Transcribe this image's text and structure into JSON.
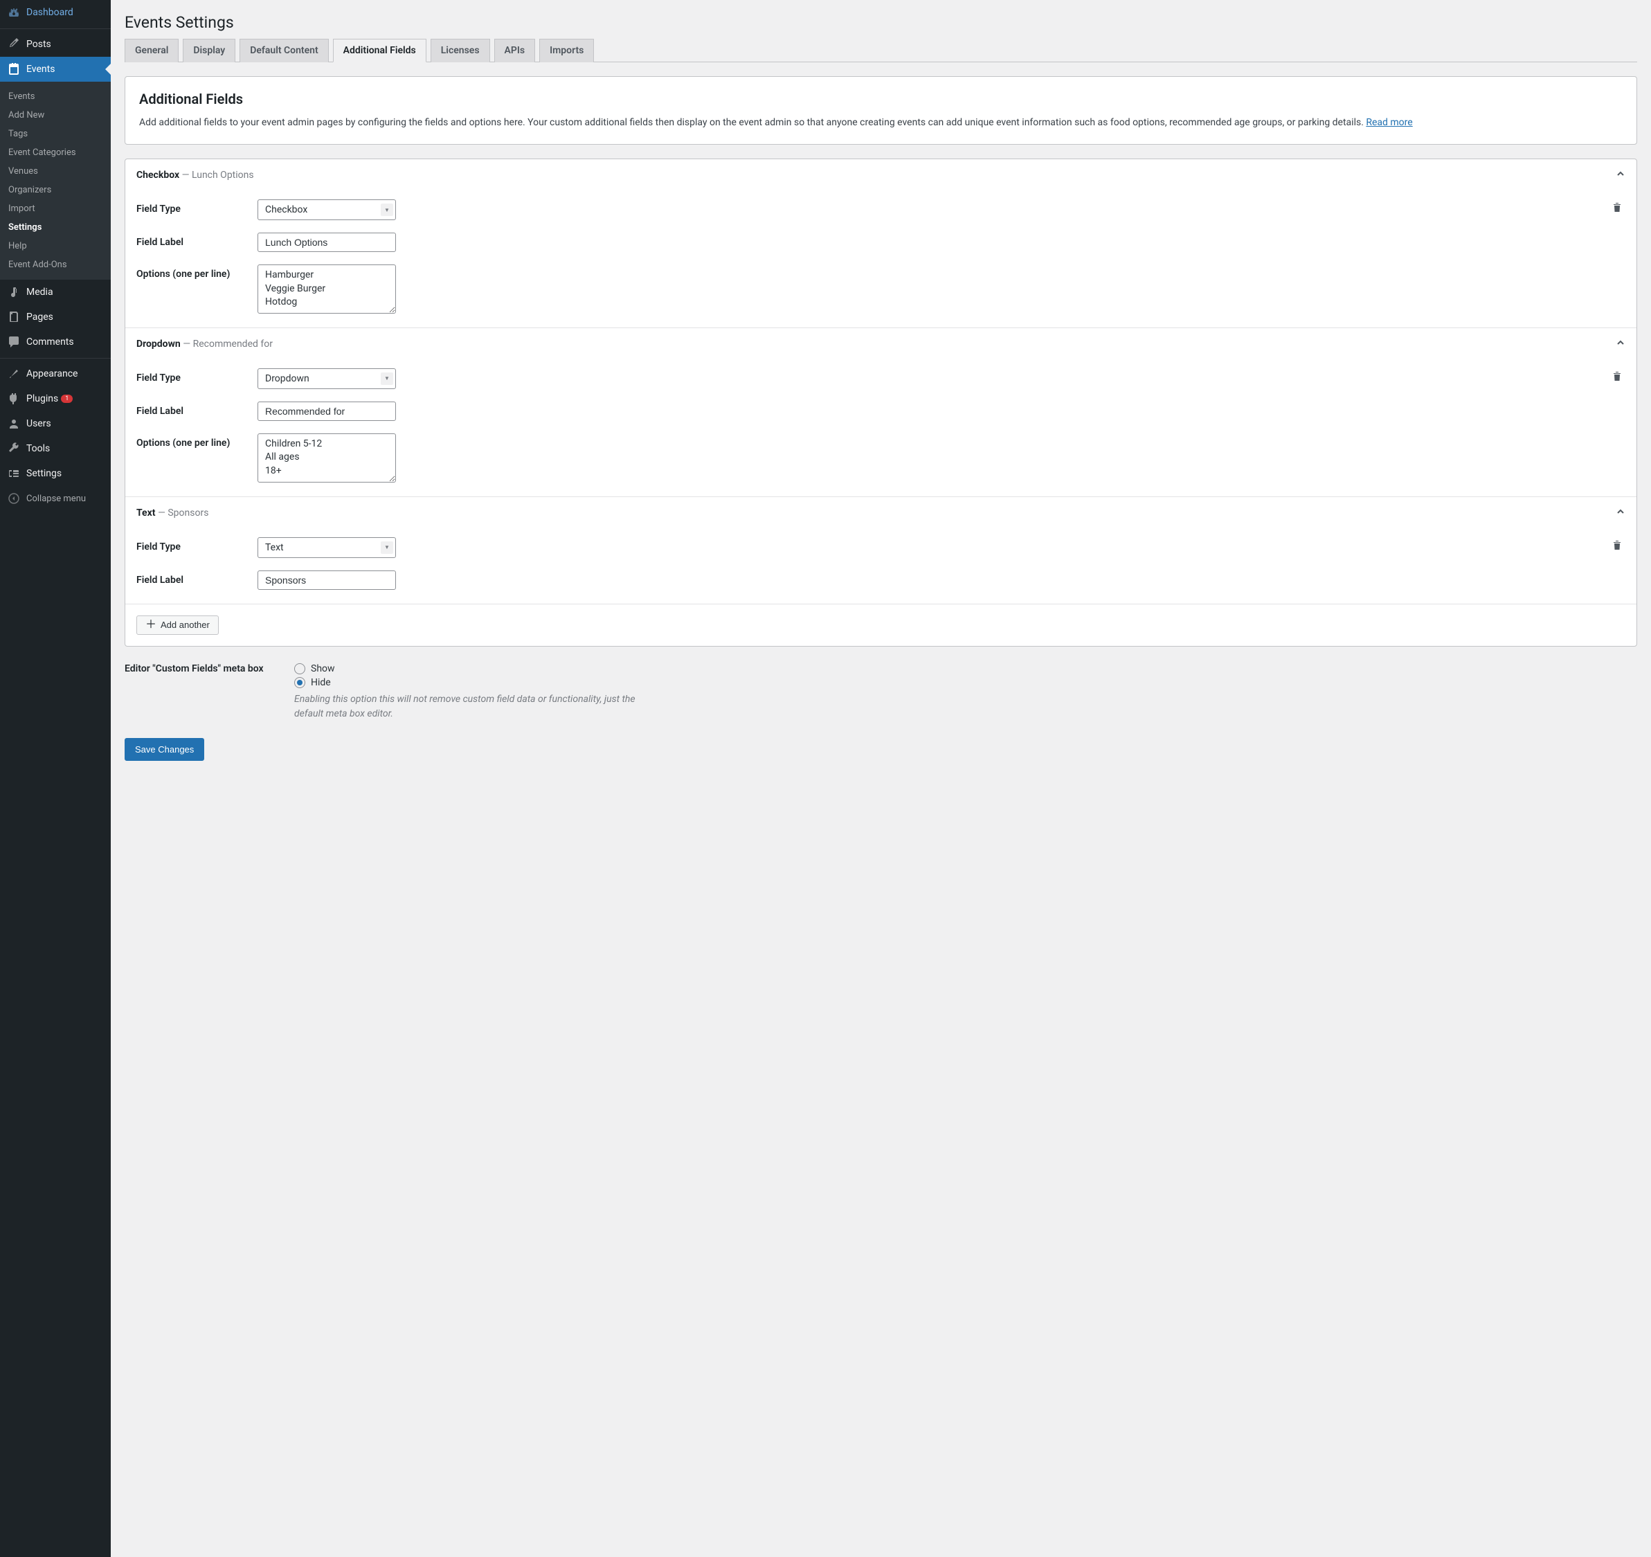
{
  "sidebar": {
    "items": [
      {
        "label": "Dashboard",
        "icon": "dashboard"
      },
      {
        "label": "Posts",
        "icon": "pin"
      },
      {
        "label": "Events",
        "icon": "calendar",
        "active": true
      },
      {
        "label": "Media",
        "icon": "media"
      },
      {
        "label": "Pages",
        "icon": "pages"
      },
      {
        "label": "Comments",
        "icon": "comments"
      },
      {
        "label": "Appearance",
        "icon": "brush"
      },
      {
        "label": "Plugins",
        "icon": "plug",
        "badge": "1"
      },
      {
        "label": "Users",
        "icon": "user"
      },
      {
        "label": "Tools",
        "icon": "wrench"
      },
      {
        "label": "Settings",
        "icon": "sliders"
      }
    ],
    "submenu": [
      {
        "label": "Events"
      },
      {
        "label": "Add New"
      },
      {
        "label": "Tags"
      },
      {
        "label": "Event Categories"
      },
      {
        "label": "Venues"
      },
      {
        "label": "Organizers"
      },
      {
        "label": "Import"
      },
      {
        "label": "Settings",
        "bold": true
      },
      {
        "label": "Help"
      },
      {
        "label": "Event Add-Ons"
      }
    ],
    "collapse_label": "Collapse menu"
  },
  "page": {
    "title": "Events Settings"
  },
  "tabs": [
    {
      "label": "General"
    },
    {
      "label": "Display"
    },
    {
      "label": "Default Content"
    },
    {
      "label": "Additional Fields",
      "active": true
    },
    {
      "label": "Licenses"
    },
    {
      "label": "APIs"
    },
    {
      "label": "Imports"
    }
  ],
  "intro": {
    "title": "Additional Fields",
    "desc": "Add additional fields to your event admin pages by configuring the fields and options here. Your custom additional fields then display on the event admin so that anyone creating events can add unique event information such as food options, recommended age groups, or parking details. ",
    "read_more": "Read more"
  },
  "labels": {
    "field_type": "Field Type",
    "field_label": "Field Label",
    "options": "Options (one per line)"
  },
  "fields": [
    {
      "type_label": "Checkbox",
      "name": "Lunch Options",
      "select_value": "Checkbox",
      "label_value": "Lunch Options",
      "options_value": "Hamburger\nVeggie Burger\nHotdog",
      "has_options": true
    },
    {
      "type_label": "Dropdown",
      "name": "Recommended for",
      "select_value": "Dropdown",
      "label_value": "Recommended for",
      "options_value": "Children 5-12\nAll ages\n18+",
      "has_options": true
    },
    {
      "type_label": "Text",
      "name": "Sponsors",
      "select_value": "Text",
      "label_value": "Sponsors",
      "has_options": false
    }
  ],
  "add_another_label": "Add another",
  "meta": {
    "label": "Editor \"Custom Fields\" meta box",
    "show_label": "Show",
    "hide_label": "Hide",
    "help": "Enabling this option this will not remove custom field data or functionality, just the default meta box editor."
  },
  "save_label": "Save Changes"
}
